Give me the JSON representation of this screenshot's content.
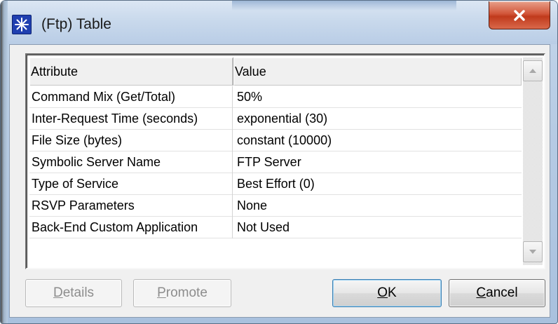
{
  "window": {
    "title": "(Ftp) Table",
    "close_icon": "close-x-icon",
    "app_icon": "star-burst-icon"
  },
  "table": {
    "columns": [
      "Attribute",
      "Value"
    ],
    "rows": [
      {
        "attribute": "Command Mix (Get/Total)",
        "value": "50%"
      },
      {
        "attribute": "Inter-Request Time (seconds)",
        "value": "exponential (30)"
      },
      {
        "attribute": "File Size (bytes)",
        "value": "constant (10000)"
      },
      {
        "attribute": "Symbolic Server Name",
        "value": "FTP Server"
      },
      {
        "attribute": "Type of Service",
        "value": "Best Effort (0)"
      },
      {
        "attribute": "RSVP Parameters",
        "value": "None"
      },
      {
        "attribute": "Back-End Custom Application",
        "value": "Not Used"
      }
    ]
  },
  "buttons": {
    "details": {
      "first": "D",
      "rest": "etails",
      "enabled": false
    },
    "promote": {
      "first": "P",
      "rest": "romote",
      "enabled": false
    },
    "ok": {
      "first": "O",
      "rest": "K",
      "enabled": true
    },
    "cancel": {
      "first": "C",
      "rest": "ancel",
      "enabled": true
    }
  },
  "colors": {
    "accent_blue": "#1f3fb0",
    "close_red": "#c03a1c"
  }
}
